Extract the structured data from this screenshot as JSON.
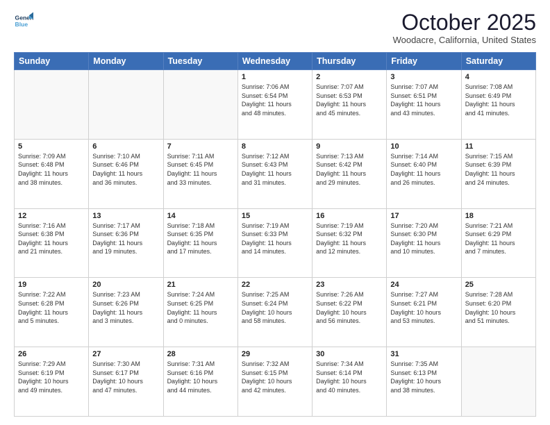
{
  "header": {
    "logo_line1": "General",
    "logo_line2": "Blue",
    "month": "October 2025",
    "location": "Woodacre, California, United States"
  },
  "weekdays": [
    "Sunday",
    "Monday",
    "Tuesday",
    "Wednesday",
    "Thursday",
    "Friday",
    "Saturday"
  ],
  "weeks": [
    [
      {
        "day": "",
        "info": ""
      },
      {
        "day": "",
        "info": ""
      },
      {
        "day": "",
        "info": ""
      },
      {
        "day": "1",
        "info": "Sunrise: 7:06 AM\nSunset: 6:54 PM\nDaylight: 11 hours\nand 48 minutes."
      },
      {
        "day": "2",
        "info": "Sunrise: 7:07 AM\nSunset: 6:53 PM\nDaylight: 11 hours\nand 45 minutes."
      },
      {
        "day": "3",
        "info": "Sunrise: 7:07 AM\nSunset: 6:51 PM\nDaylight: 11 hours\nand 43 minutes."
      },
      {
        "day": "4",
        "info": "Sunrise: 7:08 AM\nSunset: 6:49 PM\nDaylight: 11 hours\nand 41 minutes."
      }
    ],
    [
      {
        "day": "5",
        "info": "Sunrise: 7:09 AM\nSunset: 6:48 PM\nDaylight: 11 hours\nand 38 minutes."
      },
      {
        "day": "6",
        "info": "Sunrise: 7:10 AM\nSunset: 6:46 PM\nDaylight: 11 hours\nand 36 minutes."
      },
      {
        "day": "7",
        "info": "Sunrise: 7:11 AM\nSunset: 6:45 PM\nDaylight: 11 hours\nand 33 minutes."
      },
      {
        "day": "8",
        "info": "Sunrise: 7:12 AM\nSunset: 6:43 PM\nDaylight: 11 hours\nand 31 minutes."
      },
      {
        "day": "9",
        "info": "Sunrise: 7:13 AM\nSunset: 6:42 PM\nDaylight: 11 hours\nand 29 minutes."
      },
      {
        "day": "10",
        "info": "Sunrise: 7:14 AM\nSunset: 6:40 PM\nDaylight: 11 hours\nand 26 minutes."
      },
      {
        "day": "11",
        "info": "Sunrise: 7:15 AM\nSunset: 6:39 PM\nDaylight: 11 hours\nand 24 minutes."
      }
    ],
    [
      {
        "day": "12",
        "info": "Sunrise: 7:16 AM\nSunset: 6:38 PM\nDaylight: 11 hours\nand 21 minutes."
      },
      {
        "day": "13",
        "info": "Sunrise: 7:17 AM\nSunset: 6:36 PM\nDaylight: 11 hours\nand 19 minutes."
      },
      {
        "day": "14",
        "info": "Sunrise: 7:18 AM\nSunset: 6:35 PM\nDaylight: 11 hours\nand 17 minutes."
      },
      {
        "day": "15",
        "info": "Sunrise: 7:19 AM\nSunset: 6:33 PM\nDaylight: 11 hours\nand 14 minutes."
      },
      {
        "day": "16",
        "info": "Sunrise: 7:19 AM\nSunset: 6:32 PM\nDaylight: 11 hours\nand 12 minutes."
      },
      {
        "day": "17",
        "info": "Sunrise: 7:20 AM\nSunset: 6:30 PM\nDaylight: 11 hours\nand 10 minutes."
      },
      {
        "day": "18",
        "info": "Sunrise: 7:21 AM\nSunset: 6:29 PM\nDaylight: 11 hours\nand 7 minutes."
      }
    ],
    [
      {
        "day": "19",
        "info": "Sunrise: 7:22 AM\nSunset: 6:28 PM\nDaylight: 11 hours\nand 5 minutes."
      },
      {
        "day": "20",
        "info": "Sunrise: 7:23 AM\nSunset: 6:26 PM\nDaylight: 11 hours\nand 3 minutes."
      },
      {
        "day": "21",
        "info": "Sunrise: 7:24 AM\nSunset: 6:25 PM\nDaylight: 11 hours\nand 0 minutes."
      },
      {
        "day": "22",
        "info": "Sunrise: 7:25 AM\nSunset: 6:24 PM\nDaylight: 10 hours\nand 58 minutes."
      },
      {
        "day": "23",
        "info": "Sunrise: 7:26 AM\nSunset: 6:22 PM\nDaylight: 10 hours\nand 56 minutes."
      },
      {
        "day": "24",
        "info": "Sunrise: 7:27 AM\nSunset: 6:21 PM\nDaylight: 10 hours\nand 53 minutes."
      },
      {
        "day": "25",
        "info": "Sunrise: 7:28 AM\nSunset: 6:20 PM\nDaylight: 10 hours\nand 51 minutes."
      }
    ],
    [
      {
        "day": "26",
        "info": "Sunrise: 7:29 AM\nSunset: 6:19 PM\nDaylight: 10 hours\nand 49 minutes."
      },
      {
        "day": "27",
        "info": "Sunrise: 7:30 AM\nSunset: 6:17 PM\nDaylight: 10 hours\nand 47 minutes."
      },
      {
        "day": "28",
        "info": "Sunrise: 7:31 AM\nSunset: 6:16 PM\nDaylight: 10 hours\nand 44 minutes."
      },
      {
        "day": "29",
        "info": "Sunrise: 7:32 AM\nSunset: 6:15 PM\nDaylight: 10 hours\nand 42 minutes."
      },
      {
        "day": "30",
        "info": "Sunrise: 7:34 AM\nSunset: 6:14 PM\nDaylight: 10 hours\nand 40 minutes."
      },
      {
        "day": "31",
        "info": "Sunrise: 7:35 AM\nSunset: 6:13 PM\nDaylight: 10 hours\nand 38 minutes."
      },
      {
        "day": "",
        "info": ""
      }
    ]
  ]
}
